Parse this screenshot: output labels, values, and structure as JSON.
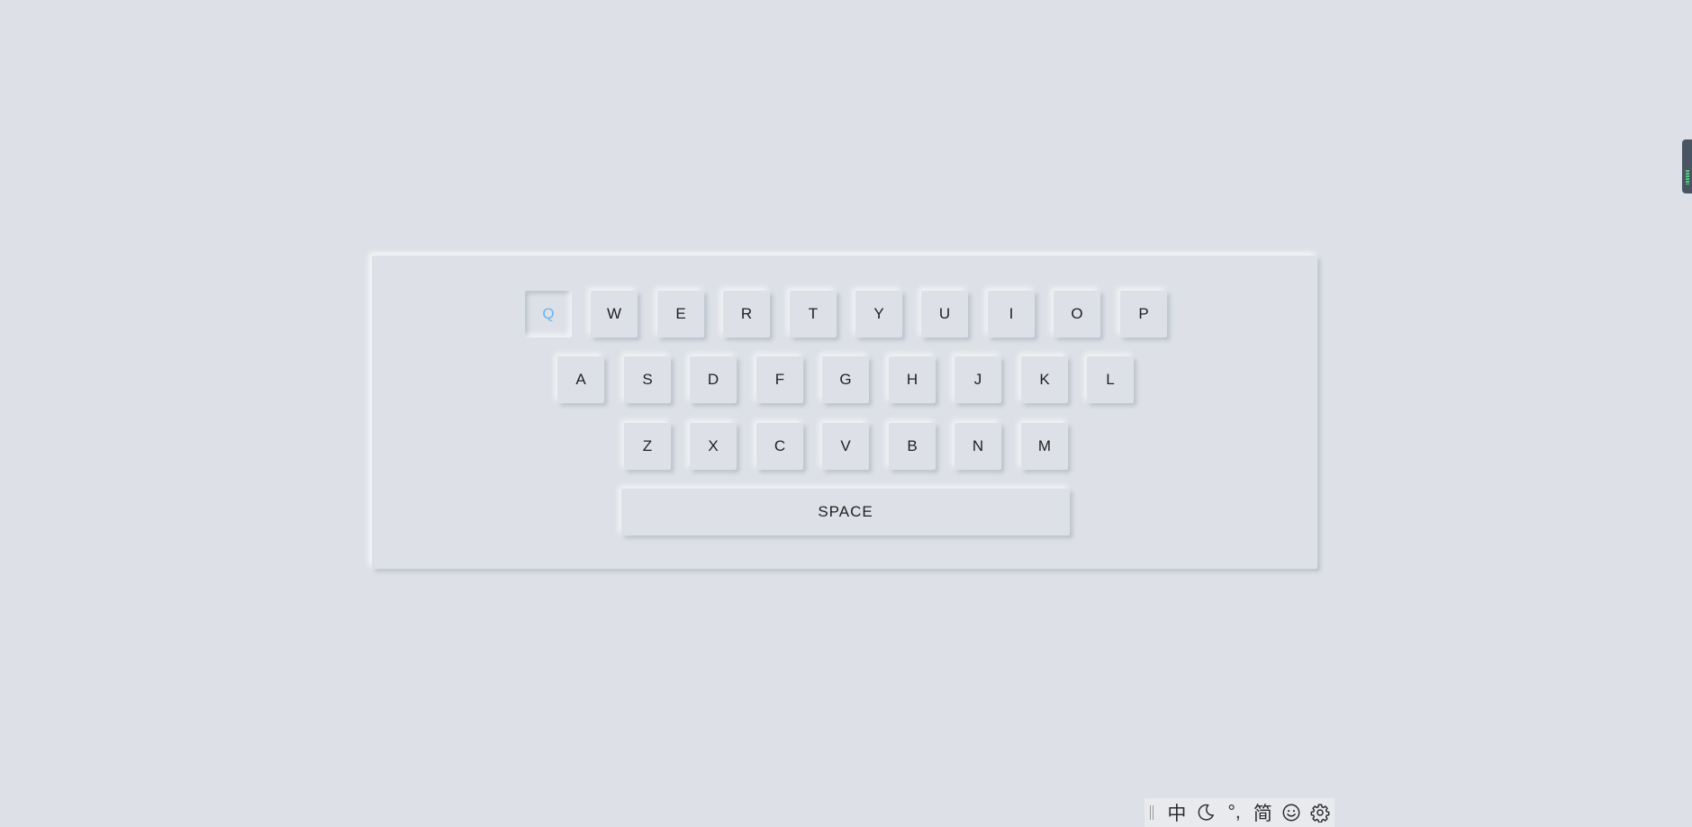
{
  "keyboard": {
    "row1": [
      "Q",
      "W",
      "E",
      "R",
      "T",
      "Y",
      "U",
      "I",
      "O",
      "P"
    ],
    "row2": [
      "A",
      "S",
      "D",
      "F",
      "G",
      "H",
      "J",
      "K",
      "L"
    ],
    "row3": [
      "Z",
      "X",
      "C",
      "V",
      "B",
      "N",
      "M"
    ],
    "space_label": "SPACE",
    "active_key": "Q"
  },
  "ime_bar": {
    "mode_label": "中",
    "punct_label": "°,",
    "script_label": "简"
  },
  "colors": {
    "background": "#dde1e7",
    "active_key": "#6ab4f0"
  }
}
